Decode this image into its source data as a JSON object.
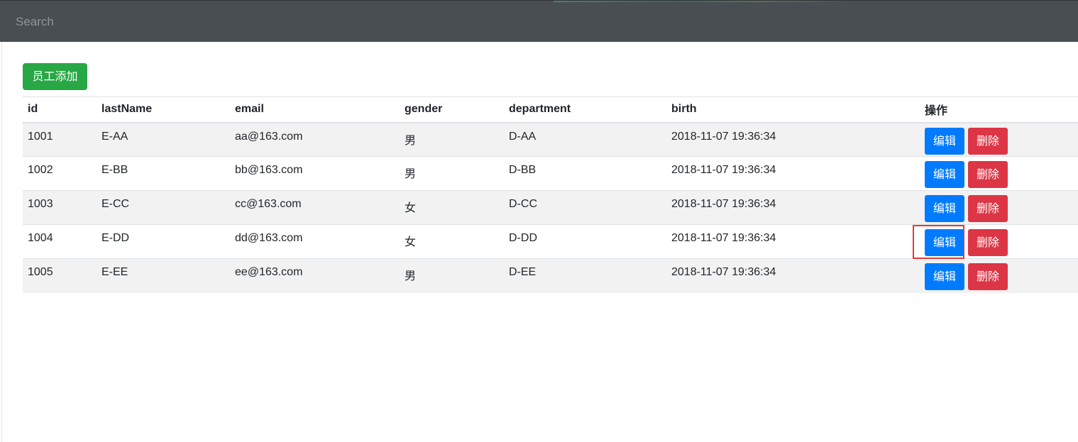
{
  "search": {
    "placeholder": "Search"
  },
  "toolbar": {
    "add_label": "员工添加"
  },
  "table": {
    "headers": [
      "id",
      "lastName",
      "email",
      "gender",
      "department",
      "birth",
      "操作"
    ],
    "rows": [
      {
        "id": "1001",
        "lastName": "E-AA",
        "email": "aa@163.com",
        "gender": "男",
        "department": "D-AA",
        "birth": "2018-11-07 19:36:34"
      },
      {
        "id": "1002",
        "lastName": "E-BB",
        "email": "bb@163.com",
        "gender": "男",
        "department": "D-BB",
        "birth": "2018-11-07 19:36:34"
      },
      {
        "id": "1003",
        "lastName": "E-CC",
        "email": "cc@163.com",
        "gender": "女",
        "department": "D-CC",
        "birth": "2018-11-07 19:36:34"
      },
      {
        "id": "1004",
        "lastName": "E-DD",
        "email": "dd@163.com",
        "gender": "女",
        "department": "D-DD",
        "birth": "2018-11-07 19:36:34"
      },
      {
        "id": "1005",
        "lastName": "E-EE",
        "email": "ee@163.com",
        "gender": "男",
        "department": "D-EE",
        "birth": "2018-11-07 19:36:34"
      }
    ],
    "edit_label": "编辑",
    "delete_label": "删除"
  },
  "colors": {
    "topbar": "#494e53",
    "add_button": "#28a745",
    "edit_button": "#007bff",
    "delete_button": "#dc3545",
    "highlight_box": "#e23a3a"
  }
}
